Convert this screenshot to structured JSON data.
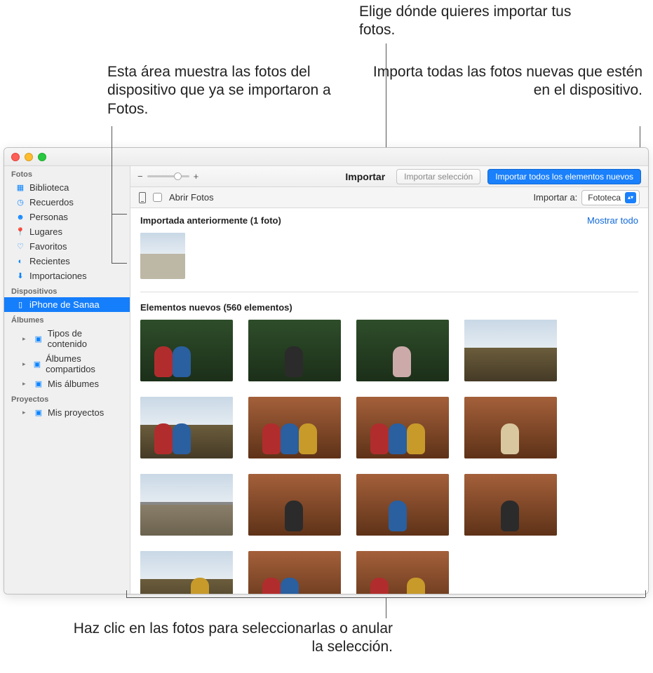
{
  "callouts": {
    "top_center": "Elige dónde quieres importar tus fotos.",
    "top_left": "Esta área muestra las fotos del dispositivo que ya se importaron a Fotos.",
    "top_right": "Importa todas las fotos nuevas que estén en el dispositivo.",
    "bottom": "Haz clic en las fotos para seleccionarlas o anular la selección."
  },
  "sidebar": {
    "sections": {
      "photos": "Fotos",
      "devices": "Dispositivos",
      "albums": "Álbumes",
      "projects": "Proyectos"
    },
    "items": {
      "library": "Biblioteca",
      "memories": "Recuerdos",
      "people": "Personas",
      "places": "Lugares",
      "favorites": "Favoritos",
      "recent": "Recientes",
      "imports": "Importaciones",
      "device": "iPhone de Sanaa",
      "content_types": "Tipos de contenido",
      "shared_albums": "Álbumes compartidos",
      "my_albums": "Mis álbumes",
      "my_projects": "Mis proyectos"
    }
  },
  "toolbar": {
    "zoom_minus": "−",
    "zoom_plus": "+",
    "title": "Importar",
    "import_selection": "Importar selección",
    "import_all_new": "Importar todos los elementos nuevos"
  },
  "subtoolbar": {
    "open_photos": "Abrir Fotos",
    "import_to_label": "Importar a:",
    "import_to_value": "Fototeca"
  },
  "sections": {
    "already_imported": "Importada anteriormente (1 foto)",
    "show_all": "Mostrar todo",
    "new_items": "Elementos nuevos (560 elementos)"
  }
}
